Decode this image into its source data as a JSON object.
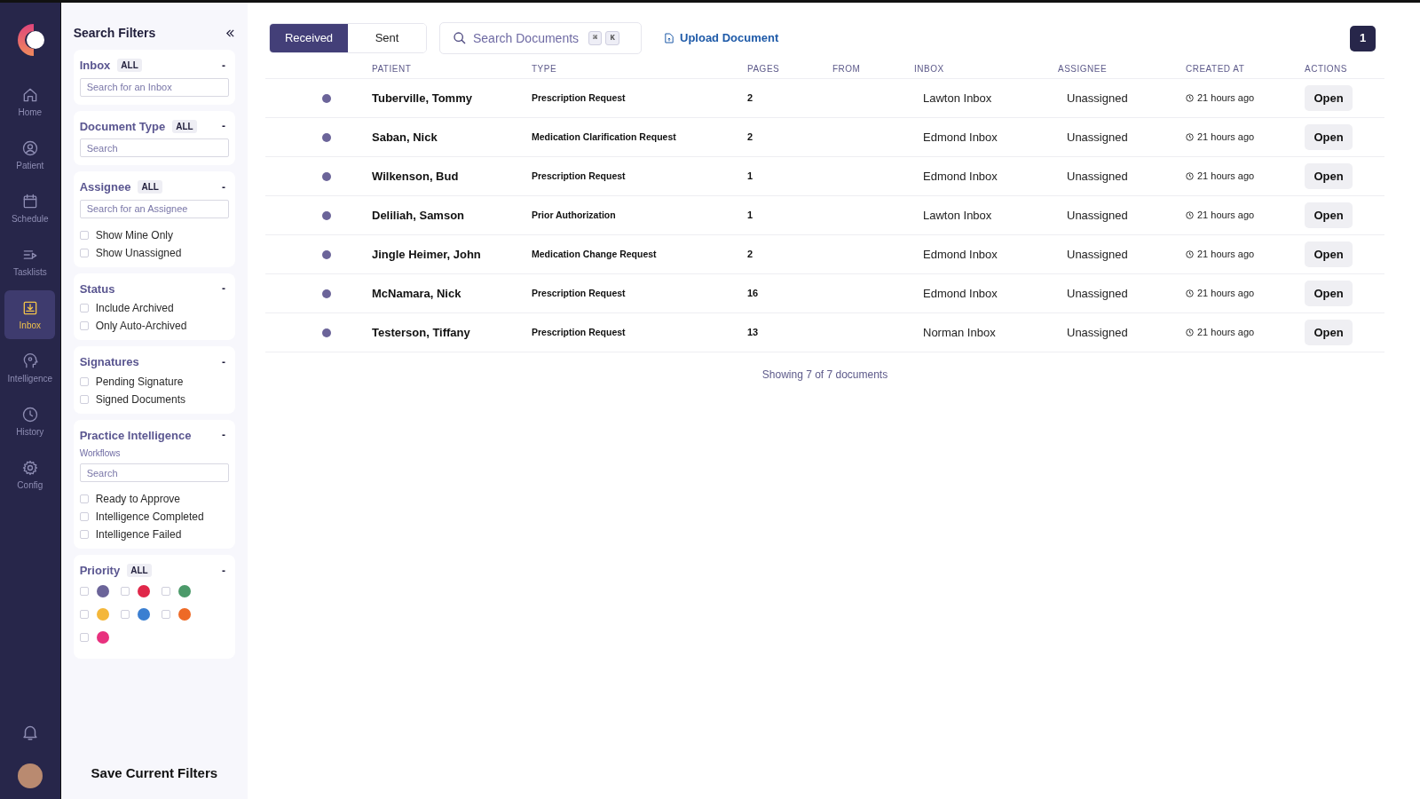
{
  "nav": {
    "items": [
      {
        "label": "Home",
        "selected": false
      },
      {
        "label": "Patient",
        "selected": false
      },
      {
        "label": "Schedule",
        "selected": false
      },
      {
        "label": "Tasklists",
        "selected": false
      },
      {
        "label": "Inbox",
        "selected": true
      },
      {
        "label": "Intelligence",
        "selected": false
      },
      {
        "label": "History",
        "selected": false
      },
      {
        "label": "Config",
        "selected": false
      }
    ]
  },
  "filters": {
    "title": "Search Filters",
    "sections": [
      {
        "title": "Inbox",
        "badge": "ALL",
        "collapse": "-",
        "placeholder": "Search for an Inbox"
      },
      {
        "title": "Document Type",
        "badge": "ALL",
        "collapse": "-",
        "placeholder": "Search"
      },
      {
        "title": "Assignee",
        "badge": "ALL",
        "collapse": "-",
        "placeholder": "Search for an Assignee",
        "options": [
          {
            "label": "Show Mine Only",
            "checked": false
          },
          {
            "label": "Show Unassigned",
            "checked": false
          }
        ]
      },
      {
        "title": "Status",
        "collapse": "-",
        "options": [
          {
            "label": "Include Archived",
            "checked": false
          },
          {
            "label": "Only Auto-Archived",
            "checked": false
          }
        ]
      },
      {
        "title": "Signatures",
        "collapse": "-",
        "options": [
          {
            "label": "Pending Signature",
            "checked": false
          },
          {
            "label": "Signed Documents",
            "checked": false
          }
        ]
      },
      {
        "title": "Practice Intelligence",
        "collapse": "-",
        "subtitle": "Workflows",
        "placeholder": "Search",
        "options": [
          {
            "label": "Ready to Approve",
            "checked": false
          },
          {
            "label": "Intelligence Completed",
            "checked": false
          },
          {
            "label": "Intelligence Failed",
            "checked": false
          }
        ]
      },
      {
        "title": "Priority",
        "badge": "ALL",
        "collapse": "-",
        "priorities": [
          {
            "color": "#6b6499",
            "checked": false
          },
          {
            "color": "#e0284a",
            "checked": false
          },
          {
            "color": "#4c9a6a",
            "checked": false
          },
          {
            "color": "#f4b73a",
            "checked": false
          },
          {
            "color": "#3b7fd1",
            "checked": false
          },
          {
            "color": "#ee6a26",
            "checked": false
          },
          {
            "color": "#e8317e",
            "checked": false
          }
        ]
      }
    ],
    "save": "Save Current Filters"
  },
  "toolbar": {
    "tabs": [
      {
        "label": "Received",
        "selected": true
      },
      {
        "label": "Sent",
        "selected": false
      }
    ],
    "search": {
      "placeholder": "Search Documents",
      "keys": [
        "⌘",
        "K"
      ]
    },
    "upload": "Upload Document",
    "page": "1"
  },
  "table": {
    "columns": [
      "PATIENT",
      "TYPE",
      "PAGES",
      "FROM",
      "INBOX",
      "ASSIGNEE",
      "CREATED AT",
      "ACTIONS"
    ],
    "rows": [
      {
        "color": "#6b6499",
        "patient": "Tuberville, Tommy",
        "type": "Prescription Request",
        "pages": "2",
        "inbox": "Lawton Inbox",
        "assignee": "Unassigned",
        "created": "21 hours ago",
        "action": "Open"
      },
      {
        "color": "#6b6499",
        "patient": "Saban, Nick",
        "type": "Medication Clarification Request",
        "pages": "2",
        "inbox": "Edmond Inbox",
        "assignee": "Unassigned",
        "created": "21 hours ago",
        "action": "Open"
      },
      {
        "color": "#6b6499",
        "patient": "Wilkenson, Bud",
        "type": "Prescription Request",
        "pages": "1",
        "inbox": "Edmond Inbox",
        "assignee": "Unassigned",
        "created": "21 hours ago",
        "action": "Open"
      },
      {
        "color": "#6b6499",
        "patient": "Deliliah, Samson",
        "type": "Prior Authorization",
        "pages": "1",
        "inbox": "Lawton Inbox",
        "assignee": "Unassigned",
        "created": "21 hours ago",
        "action": "Open"
      },
      {
        "color": "#6b6499",
        "patient": "Jingle Heimer, John",
        "type": "Medication Change Request",
        "pages": "2",
        "inbox": "Edmond Inbox",
        "assignee": "Unassigned",
        "created": "21 hours ago",
        "action": "Open"
      },
      {
        "color": "#6b6499",
        "patient": "McNamara, Nick",
        "type": "Prescription Request",
        "pages": "16",
        "inbox": "Edmond Inbox",
        "assignee": "Unassigned",
        "created": "21 hours ago",
        "action": "Open"
      },
      {
        "color": "#6b6499",
        "patient": "Testerson, Tiffany",
        "type": "Prescription Request",
        "pages": "13",
        "inbox": "Norman Inbox",
        "assignee": "Unassigned",
        "created": "21 hours ago",
        "action": "Open"
      }
    ],
    "footer": "Showing 7 of 7 documents"
  }
}
